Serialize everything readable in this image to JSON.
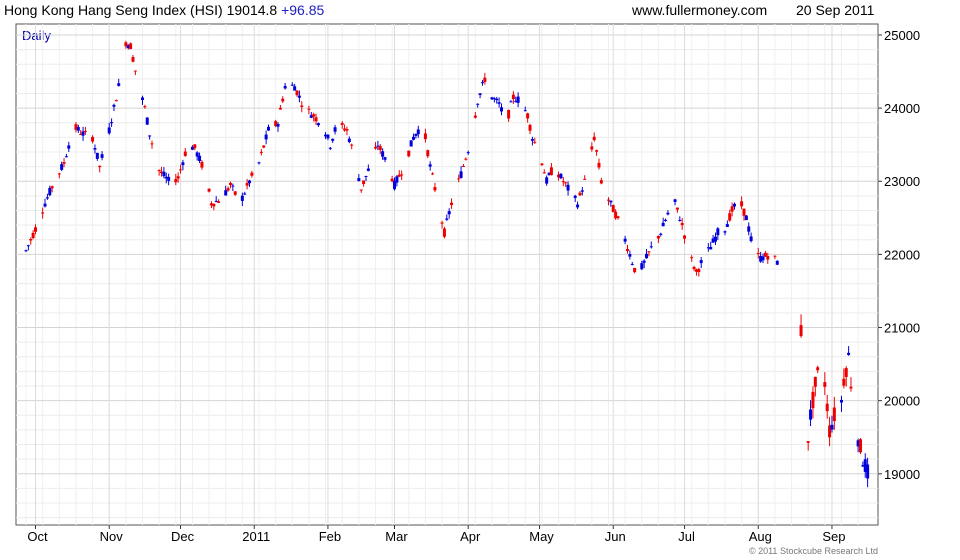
{
  "header": {
    "index_name": "Hong Kong Hang Seng Index (HSI)",
    "last_value": "19014.8",
    "change": "+96.85",
    "website": "www.fullermoney.com",
    "date": "20 Sep 2011"
  },
  "copyright": "© 2011 Stockcube Research Ltd",
  "colors": {
    "up": "#0000dd",
    "down": "#ee0000",
    "grid": "#d4d4d4",
    "period_label": "#0000aa"
  },
  "chart_data": {
    "type": "candlestick",
    "period_label": "Daily",
    "ylim": [
      18300,
      25150
    ],
    "y_ticks": [
      19000,
      20000,
      21000,
      22000,
      23000,
      24000,
      25000
    ],
    "x_labels": [
      {
        "label": "Oct",
        "day": 4
      },
      {
        "label": "Nov",
        "day": 35
      },
      {
        "label": "Dec",
        "day": 65
      },
      {
        "label": "2011",
        "day": 96
      },
      {
        "label": "Feb",
        "day": 127
      },
      {
        "label": "Mar",
        "day": 155
      },
      {
        "label": "Apr",
        "day": 186
      },
      {
        "label": "May",
        "day": 216
      },
      {
        "label": "Jun",
        "day": 247
      },
      {
        "label": "Jul",
        "day": 277
      },
      {
        "label": "Aug",
        "day": 308
      },
      {
        "label": "Sep",
        "day": 339
      }
    ],
    "day_range": [
      0,
      355
    ],
    "gaps": [
      [
        316,
        326
      ]
    ],
    "anchors": [
      [
        0,
        22050
      ],
      [
        4,
        22350
      ],
      [
        8,
        22700
      ],
      [
        12,
        23000
      ],
      [
        16,
        23250
      ],
      [
        20,
        23750
      ],
      [
        24,
        23650
      ],
      [
        28,
        23600
      ],
      [
        31,
        23200
      ],
      [
        35,
        23700
      ],
      [
        39,
        24300
      ],
      [
        42,
        24900
      ],
      [
        44,
        24850
      ],
      [
        47,
        24350
      ],
      [
        50,
        24000
      ],
      [
        52,
        23650
      ],
      [
        56,
        23150
      ],
      [
        60,
        23000
      ],
      [
        64,
        23050
      ],
      [
        68,
        23500
      ],
      [
        71,
        23450
      ],
      [
        75,
        23150
      ],
      [
        78,
        22700
      ],
      [
        82,
        22750
      ],
      [
        86,
        22950
      ],
      [
        90,
        22700
      ],
      [
        94,
        23000
      ],
      [
        98,
        23250
      ],
      [
        102,
        23700
      ],
      [
        106,
        23800
      ],
      [
        109,
        24300
      ],
      [
        113,
        24300
      ],
      [
        117,
        24000
      ],
      [
        121,
        23900
      ],
      [
        125,
        23750
      ],
      [
        128,
        23500
      ],
      [
        131,
        23800
      ],
      [
        135,
        23700
      ],
      [
        138,
        23350
      ],
      [
        141,
        22900
      ],
      [
        144,
        23150
      ],
      [
        148,
        23500
      ],
      [
        152,
        23250
      ],
      [
        155,
        22950
      ],
      [
        159,
        23200
      ],
      [
        163,
        23600
      ],
      [
        167,
        23800
      ],
      [
        170,
        23200
      ],
      [
        173,
        22750
      ],
      [
        176,
        22300
      ],
      [
        179,
        22700
      ],
      [
        183,
        23100
      ],
      [
        187,
        23550
      ],
      [
        190,
        24100
      ],
      [
        193,
        24400
      ],
      [
        196,
        24150
      ],
      [
        199,
        24050
      ],
      [
        202,
        23800
      ],
      [
        205,
        24150
      ],
      [
        208,
        24100
      ],
      [
        211,
        23900
      ],
      [
        213,
        23600
      ],
      [
        216,
        23400
      ],
      [
        219,
        23000
      ],
      [
        222,
        23200
      ],
      [
        226,
        23000
      ],
      [
        229,
        22850
      ],
      [
        232,
        22700
      ],
      [
        236,
        23100
      ],
      [
        239,
        23600
      ],
      [
        242,
        23000
      ],
      [
        245,
        22750
      ],
      [
        248,
        22550
      ],
      [
        251,
        22300
      ],
      [
        254,
        22000
      ],
      [
        257,
        21700
      ],
      [
        261,
        21950
      ],
      [
        264,
        22150
      ],
      [
        267,
        22300
      ],
      [
        270,
        22550
      ],
      [
        273,
        22700
      ],
      [
        276,
        22400
      ],
      [
        279,
        22000
      ],
      [
        282,
        21750
      ],
      [
        285,
        21950
      ],
      [
        288,
        22100
      ],
      [
        291,
        22300
      ],
      [
        294,
        22350
      ],
      [
        297,
        22600
      ],
      [
        300,
        22750
      ],
      [
        303,
        22500
      ],
      [
        306,
        22050
      ],
      [
        309,
        21950
      ],
      [
        313,
        22000
      ],
      [
        316,
        21900
      ],
      [
        326,
        20950
      ],
      [
        328,
        19200
      ],
      [
        330,
        19800
      ],
      [
        332,
        20200
      ],
      [
        334,
        20500
      ],
      [
        336,
        20250
      ],
      [
        338,
        19600
      ],
      [
        340,
        19800
      ],
      [
        342,
        19700
      ],
      [
        344,
        20300
      ],
      [
        346,
        20600
      ],
      [
        348,
        19900
      ],
      [
        350,
        19500
      ],
      [
        352,
        19200
      ],
      [
        354,
        19014
      ]
    ]
  }
}
